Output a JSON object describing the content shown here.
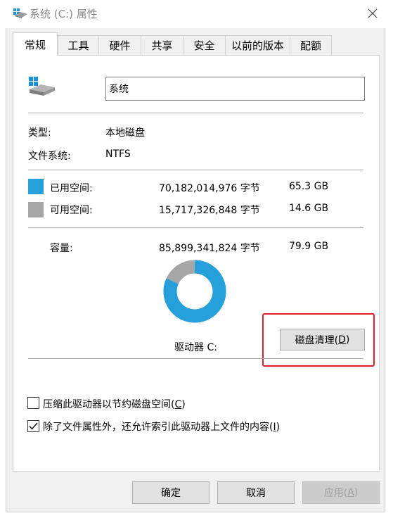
{
  "window": {
    "title": "系统 (C:) 属性",
    "title_icon": "drive-icon",
    "close_icon": "close-icon"
  },
  "tabs": [
    {
      "label": "常规",
      "active": true
    },
    {
      "label": "工具"
    },
    {
      "label": "硬件"
    },
    {
      "label": "共享"
    },
    {
      "label": "安全"
    },
    {
      "label": "以前的版本"
    },
    {
      "label": "配额"
    }
  ],
  "general": {
    "drive_icon": "hard-drive-icon",
    "name_value": "系统",
    "type_label": "类型:",
    "type_value": "本地磁盘",
    "fs_label": "文件系统:",
    "fs_value": "NTFS",
    "used": {
      "label": "已用空间:",
      "bytes": "70,182,014,976 字节",
      "size": "65.3 GB",
      "color": "#26a0da"
    },
    "free": {
      "label": "可用空间:",
      "bytes": "15,717,326,848 字节",
      "size": "14.6 GB",
      "color": "#a6a6a6"
    },
    "capacity": {
      "label": "容量:",
      "bytes": "85,899,341,824 字节",
      "size": "79.9 GB"
    },
    "used_fraction": 0.817,
    "drive_label": "驱动器 C:",
    "cleanup_button": {
      "text": "磁盘清理(",
      "key": "D",
      "suffix": ")"
    }
  },
  "options": {
    "compress": {
      "text": "压缩此驱动器以节约磁盘空间(",
      "key": "C",
      "suffix": ")",
      "checked": false
    },
    "index": {
      "text": "除了文件属性外，还允许索引此驱动器上文件的内容(",
      "key": "I",
      "suffix": ")",
      "checked": true
    }
  },
  "buttons": {
    "ok": "确定",
    "cancel": "取消",
    "apply": {
      "text": "应用(",
      "key": "A",
      "suffix": ")"
    }
  },
  "accent_colors": {
    "highlight": "#e0212b"
  }
}
